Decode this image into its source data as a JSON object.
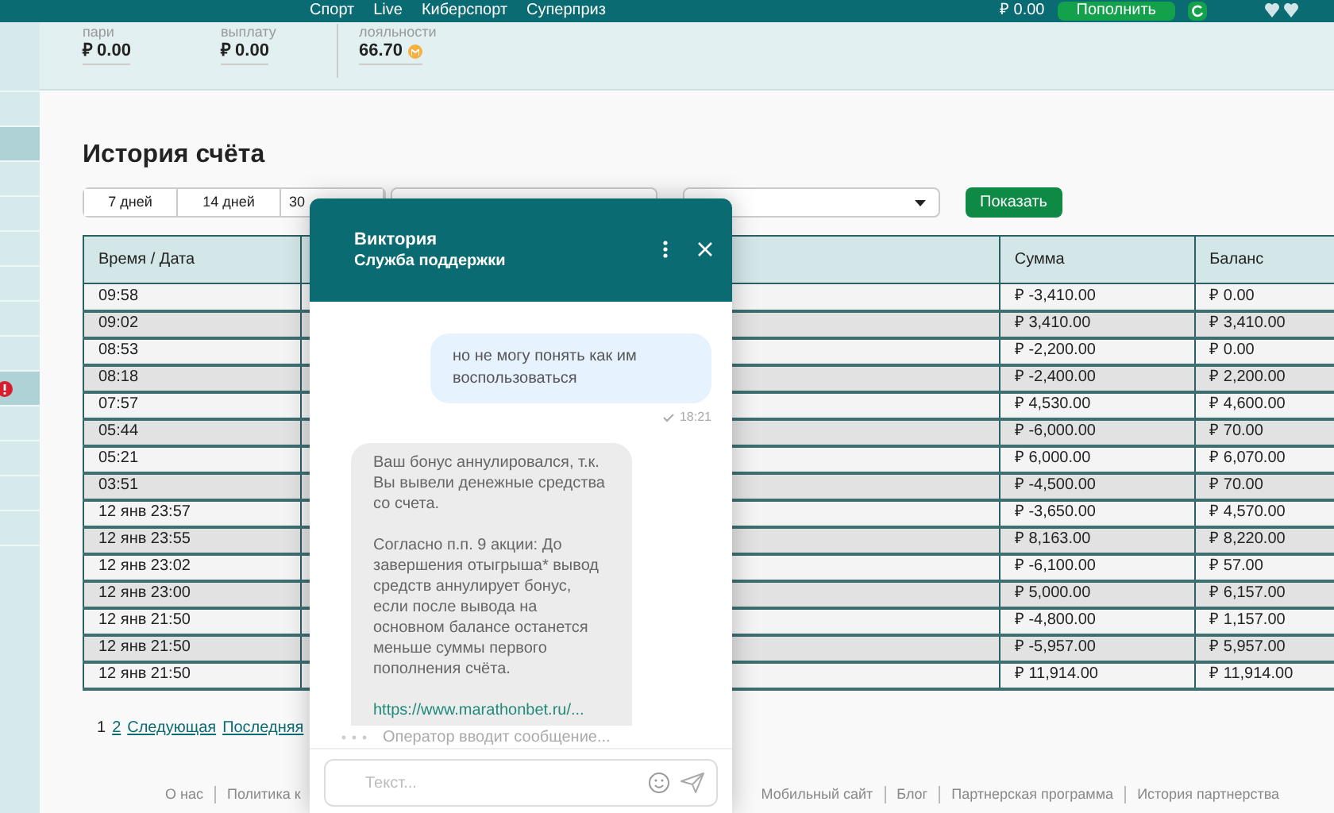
{
  "top_nav": {
    "items": [
      "Спорт",
      "Live",
      "Киберспорт",
      "Суперприз"
    ],
    "balance": "₽ 0.00",
    "deposit_button": "Пополнить"
  },
  "sidebar": {
    "items": [
      {
        "selected": false,
        "alert": false
      },
      {
        "selected": false,
        "alert": false
      },
      {
        "selected": true,
        "alert": false
      },
      {
        "selected": false,
        "alert": false
      },
      {
        "selected": false,
        "alert": false
      },
      {
        "selected": false,
        "alert": false
      },
      {
        "selected": false,
        "alert": false
      },
      {
        "selected": false,
        "alert": false
      },
      {
        "selected": false,
        "alert": false
      },
      {
        "selected": true,
        "alert": true
      },
      {
        "selected": false,
        "alert": false
      },
      {
        "selected": false,
        "alert": false
      },
      {
        "selected": false,
        "alert": false
      },
      {
        "selected": false,
        "alert": false
      }
    ]
  },
  "stats": [
    {
      "label": "пари",
      "value": "₽ 0.00",
      "coin": false
    },
    {
      "label": "выплату",
      "value": "₽ 0.00",
      "coin": false
    },
    {
      "label": "лояльности",
      "value": "66.70",
      "coin": true
    }
  ],
  "title": "История счёта",
  "period_tabs": [
    {
      "label": "7 дней",
      "selected": false
    },
    {
      "label": "14 дней",
      "selected": false
    },
    {
      "label": "30",
      "selected": false
    }
  ],
  "show_button": "Показать",
  "table": {
    "columns": [
      "Время / Дата",
      "Сумма",
      "Баланс"
    ],
    "rows": [
      [
        "09:58",
        "₽ -3,410.00",
        "₽ 0.00"
      ],
      [
        "09:02",
        "₽ 3,410.00",
        "₽ 3,410.00"
      ],
      [
        "08:53",
        "₽ -2,200.00",
        "₽ 0.00"
      ],
      [
        "08:18",
        "₽ -2,400.00",
        "₽ 2,200.00"
      ],
      [
        "07:57",
        "₽ 4,530.00",
        "₽ 4,600.00"
      ],
      [
        "05:44",
        "₽ -6,000.00",
        "₽ 70.00"
      ],
      [
        "05:21",
        "₽ 6,000.00",
        "₽ 6,070.00"
      ],
      [
        "03:51",
        "₽ -4,500.00",
        "₽ 70.00"
      ],
      [
        "12 янв 23:57",
        "₽ -3,650.00",
        "₽ 4,570.00"
      ],
      [
        "12 янв 23:55",
        "₽ 8,163.00",
        "₽ 8,220.00"
      ],
      [
        "12 янв 23:02",
        "₽ -6,100.00",
        "₽ 57.00"
      ],
      [
        "12 янв 23:00",
        "₽ 5,000.00",
        "₽ 6,157.00"
      ],
      [
        "12 янв 21:50",
        "₽ -4,800.00",
        "₽ 1,157.00"
      ],
      [
        "12 янв 21:50",
        "₽ -5,957.00",
        "₽ 5,957.00"
      ],
      [
        "12 янв 21:50",
        "₽ 11,914.00",
        "₽ 11,914.00"
      ]
    ]
  },
  "pagination": [
    {
      "label": "1",
      "selected": true
    },
    {
      "label": "2",
      "selected": false
    },
    {
      "label": "Следующая",
      "selected": false
    },
    {
      "label": "Последняя",
      "selected": false
    }
  ],
  "footer": {
    "left": [
      "О нас",
      "Политика к"
    ],
    "right": [
      "Мобильный сайт",
      "Блог",
      "Партнерская программа",
      "История партнерства"
    ]
  },
  "chat": {
    "name": "Виктория",
    "subtitle": "Служба поддержки",
    "messages": [
      {
        "kind": "outgoing",
        "text": "но не могу понять как им воспользоваться",
        "time": "18:21"
      },
      {
        "kind": "incoming",
        "paragraphs": [
          "Ваш бонус аннулировался, т.к. Вы вывели денежные средства со счета.",
          "Согласно п.п. 9 акции: До завершения отыгрыша* вывод средств аннулирует бонус, если после вывода на основном балансе останется меньше суммы первого пополнения счёта."
        ],
        "link": "https://www.marathonbet.ru/..."
      }
    ],
    "typing": "Оператор вводит сообщение...",
    "input_placeholder": "Текст..."
  }
}
